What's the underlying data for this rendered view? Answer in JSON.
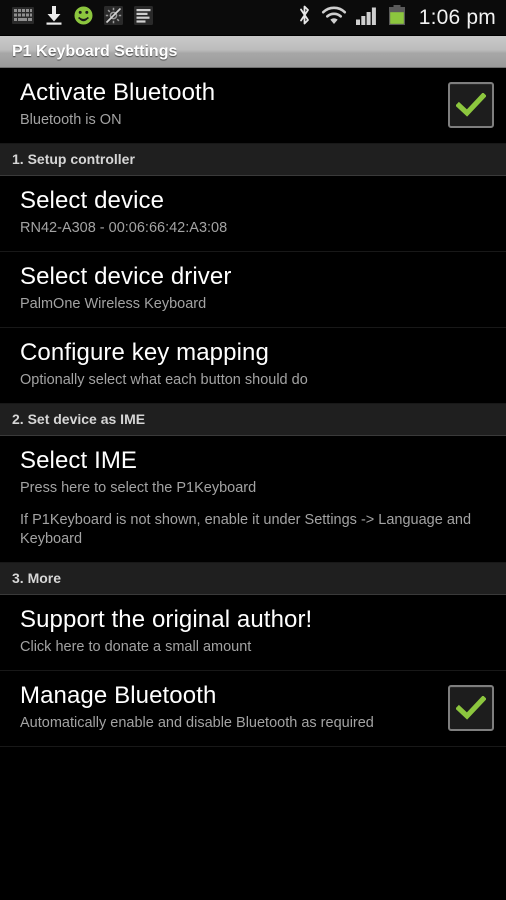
{
  "statusbar": {
    "left_icons": [
      "keyboard-icon",
      "download-icon",
      "android-icon",
      "sync-disabled-icon",
      "list-icon"
    ],
    "right_icons": [
      "bluetooth-icon",
      "wifi-icon",
      "cellular-signal-icon",
      "battery-icon"
    ],
    "clock": "1:06 pm"
  },
  "titlebar": {
    "title": "P1 Keyboard Settings"
  },
  "colors": {
    "accent_green": "#8cc63e",
    "status_green": "#8cc63e",
    "title_bar": "#b5b5b5",
    "section_header_bg": "#1f1f1f",
    "background": "#000000"
  },
  "list": [
    {
      "type": "item",
      "name": "activate-bluetooth",
      "title": "Activate Bluetooth",
      "summary": "Bluetooth is ON",
      "widget": "checkbox",
      "checked": true
    },
    {
      "type": "header",
      "name": "setup-controller",
      "title": "1. Setup controller"
    },
    {
      "type": "item",
      "name": "select-device",
      "title": "Select device",
      "summary": "RN42-A308 - 00:06:66:42:A3:08",
      "widget": "none"
    },
    {
      "type": "item",
      "name": "select-device-driver",
      "title": "Select device driver",
      "summary": "PalmOne Wireless Keyboard",
      "widget": "none"
    },
    {
      "type": "item",
      "name": "configure-key-mapping",
      "title": "Configure key mapping",
      "summary": "Optionally select what each button should do",
      "widget": "none"
    },
    {
      "type": "header",
      "name": "set-device-as-ime",
      "title": "2. Set device as IME"
    },
    {
      "type": "item",
      "name": "select-ime",
      "title": "Select IME",
      "summary": "Press here to select the P1Keyboard",
      "summary2": "If P1Keyboard is not shown, enable it under Settings -> Language and Keyboard",
      "widget": "none"
    },
    {
      "type": "header",
      "name": "more",
      "title": "3. More"
    },
    {
      "type": "item",
      "name": "support-the-original-author",
      "title": "Support the original author!",
      "summary": "Click here to donate a small amount",
      "widget": "none"
    },
    {
      "type": "item",
      "name": "manage-bluetooth",
      "title": "Manage Bluetooth",
      "summary": "Automatically enable and disable Bluetooth as required",
      "widget": "checkbox",
      "checked": true
    }
  ]
}
